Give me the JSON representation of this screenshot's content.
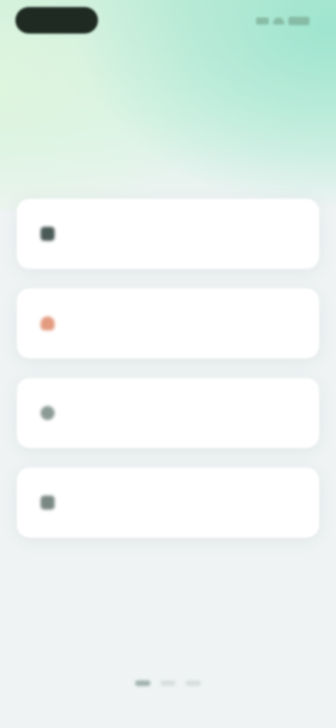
{
  "status_bar": {
    "icons": [
      "signal-icon",
      "wifi-icon",
      "battery-icon"
    ]
  },
  "header": {
    "title": "",
    "subtitle_line1": "",
    "subtitle_line2": ""
  },
  "cards": [
    {
      "label": "",
      "icon": "device-icon",
      "icon_color": "#4a5a56"
    },
    {
      "label": "",
      "icon": "flame-icon",
      "icon_color": "#e39b7f"
    },
    {
      "label": "",
      "icon": "person-icon",
      "icon_color": "#8c9a96"
    },
    {
      "label": "",
      "icon": "chart-icon",
      "icon_color": "#7a8884"
    }
  ],
  "colors": {
    "accent": "#9ce4ce",
    "background": "#eff3f4",
    "text_dark": "#1f2b26"
  },
  "pagination": {
    "count": 3,
    "active_index": 0
  }
}
